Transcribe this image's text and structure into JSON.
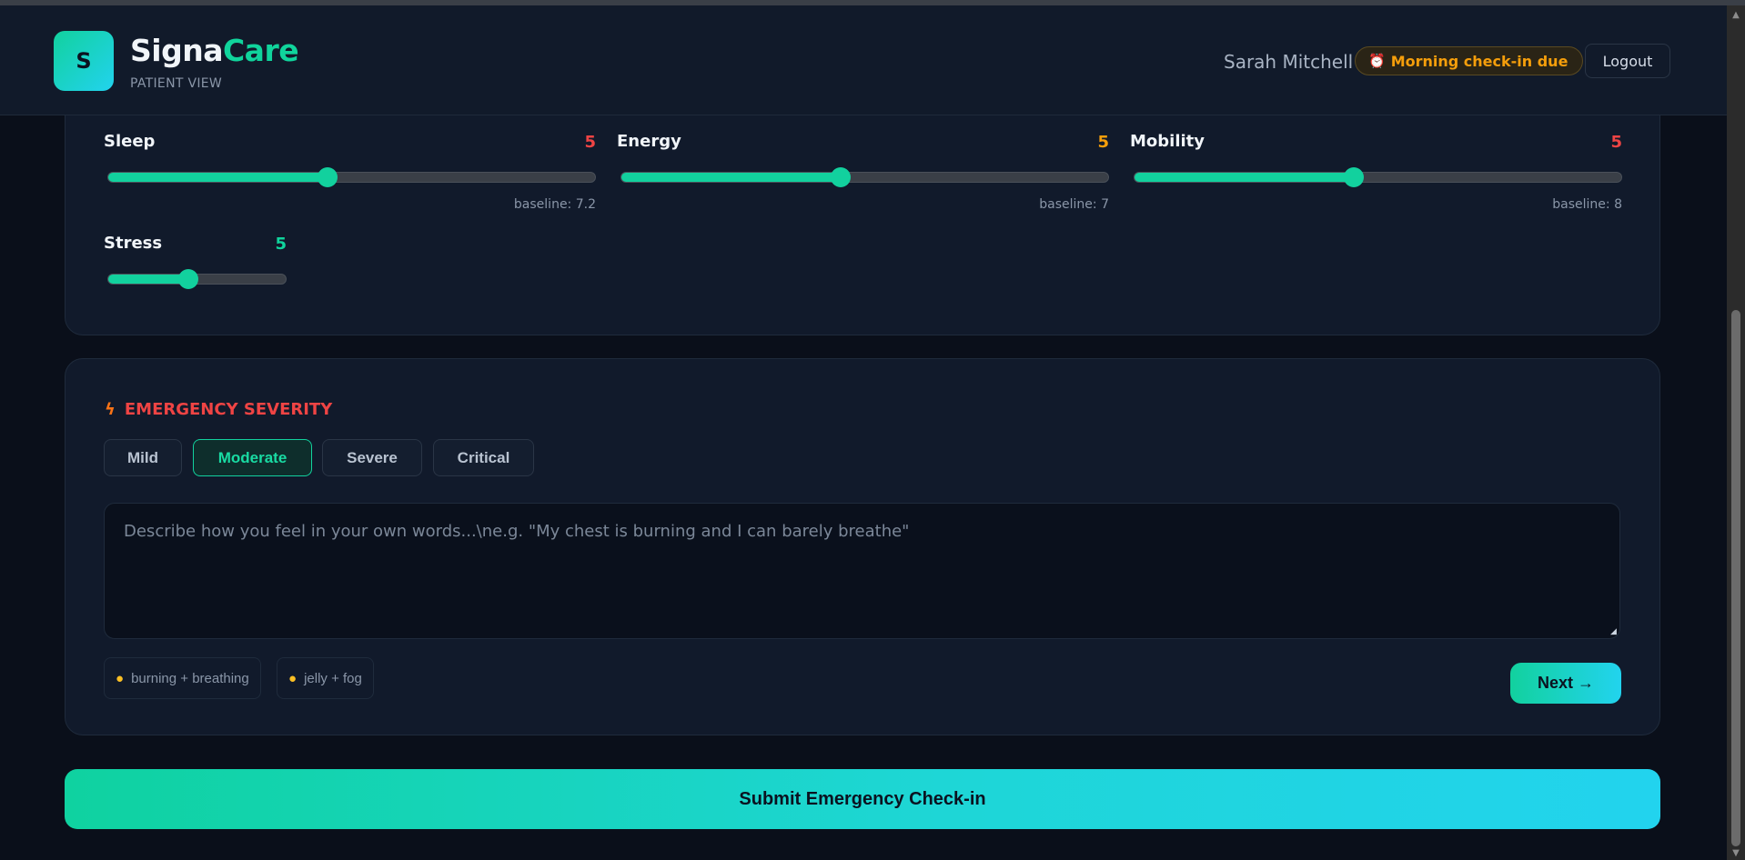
{
  "header": {
    "logo_letter": "S",
    "brand_part1": "Signa",
    "brand_part2": "Care",
    "subtitle": "PATIENT VIEW",
    "user_name": "Sarah Mitchell",
    "badge_icon": "alarm-clock-icon",
    "badge_text": "Morning check-in due",
    "logout_label": "Logout"
  },
  "metrics": [
    {
      "label": "Sleep",
      "value": "5",
      "value_color": "#ef4444",
      "level": 0.45,
      "baseline": "baseline: 7.2"
    },
    {
      "label": "Energy",
      "value": "5",
      "value_color": "#f59e0b",
      "level": 0.45,
      "baseline": "baseline: 7"
    },
    {
      "label": "Mobility",
      "value": "5",
      "value_color": "#ef4444",
      "level": 0.45,
      "baseline": "baseline: 8"
    },
    {
      "label": "Stress",
      "value": "5",
      "value_color": "#10d49c",
      "level": 0.45
    }
  ],
  "emergency": {
    "icon": "lightning-bolt-icon",
    "title": "EMERGENCY SEVERITY",
    "options": [
      "Mild",
      "Moderate",
      "Severe",
      "Critical"
    ],
    "selected": "Moderate",
    "description_placeholder": "Describe how you feel in your own words...\\ne.g. \"My chest is burning and I can barely breathe\"",
    "description_value": "",
    "hints": [
      {
        "icon": "lightbulb-icon",
        "label": "burning + breathing"
      },
      {
        "icon": "lightbulb-icon",
        "label": "jelly + fog"
      }
    ],
    "next_label": "Next →"
  },
  "submit_label": "Submit Emergency Check-in",
  "colors": {
    "accent": "#12d19e",
    "accent2": "#22d3ee",
    "background": "#0a0f1a",
    "card": "#111a2b",
    "danger": "#ef4444",
    "warning": "#f59e0b"
  }
}
